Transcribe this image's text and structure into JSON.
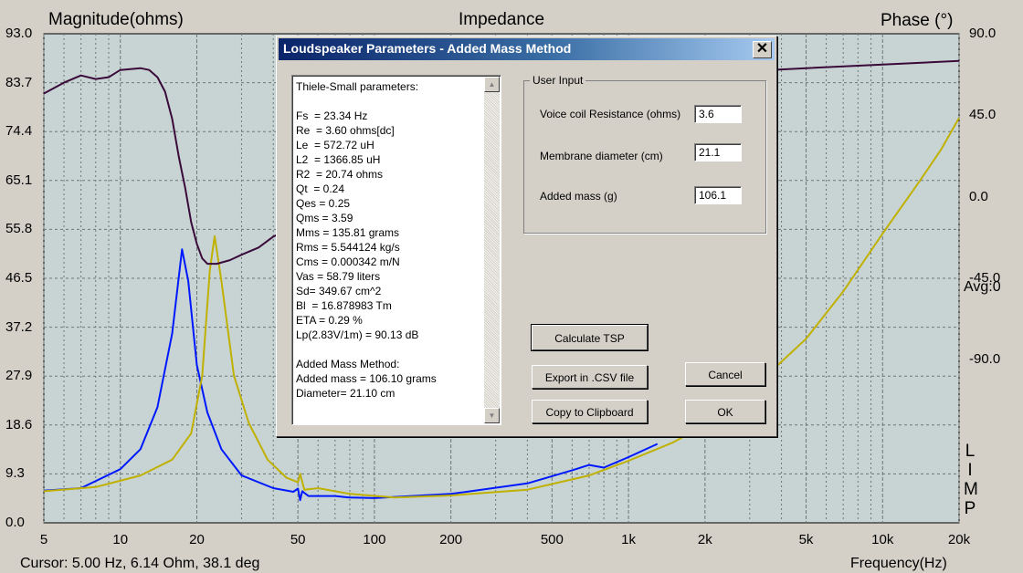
{
  "graph": {
    "title": "Impedance",
    "left_axis_title": "Magnitude(ohms)",
    "right_axis_title": "Phase (°)",
    "x_axis_title": "Frequency(Hz)",
    "avg_label": "Avg:0",
    "limp_letters": [
      "L",
      "I",
      "M",
      "P"
    ],
    "colors": {
      "background": "#c7d4d3",
      "grid": "#6e7676",
      "magnitude": "#0018ff",
      "magnitude_added_mass": "#c0b000",
      "phase": "#3a0a3a"
    }
  },
  "chart_data": {
    "type": "line",
    "title": "Impedance",
    "xlabel": "Frequency(Hz)",
    "ylabel": "Magnitude(ohms)",
    "y2label": "Phase (°)",
    "x_scale": "log",
    "xlim": [
      5,
      20000
    ],
    "ylim": [
      0.0,
      93.0
    ],
    "y2lim": [
      -180.0,
      90.0
    ],
    "x_ticks": [
      "5",
      "10",
      "20",
      "50",
      "100",
      "200",
      "500",
      "1k",
      "2k",
      "5k",
      "10k",
      "20k"
    ],
    "y_ticks": [
      "93.0",
      "83.7",
      "74.4",
      "65.1",
      "55.8",
      "46.5",
      "37.2",
      "27.9",
      "18.6",
      "9.3",
      "0.0"
    ],
    "y2_ticks": [
      "90.0",
      "45.0",
      "0.0",
      "-45.0",
      "-90.0"
    ],
    "grid": true,
    "series": [
      {
        "axis": "left",
        "color": "#0018ff",
        "points": [
          [
            5,
            6.1
          ],
          [
            7,
            6.6
          ],
          [
            10,
            10.2
          ],
          [
            12,
            14
          ],
          [
            14,
            22
          ],
          [
            16,
            36
          ],
          [
            17.5,
            52
          ],
          [
            18.5,
            46
          ],
          [
            20,
            30
          ],
          [
            22,
            21
          ],
          [
            25,
            14
          ],
          [
            30,
            9
          ],
          [
            40,
            6.6
          ],
          [
            48,
            5.9
          ],
          [
            50,
            6.5
          ],
          [
            51,
            4.3
          ],
          [
            52,
            6.0
          ],
          [
            55,
            5.1
          ],
          [
            70,
            5.1
          ],
          [
            80,
            4.8
          ],
          [
            100,
            4.7
          ],
          [
            200,
            5.5
          ],
          [
            400,
            7.5
          ],
          [
            600,
            10
          ],
          [
            700,
            11
          ],
          [
            800,
            10.5
          ],
          [
            1000,
            12.5
          ],
          [
            1300,
            15
          ]
        ]
      },
      {
        "axis": "left",
        "color": "#c0b000",
        "points": [
          [
            5,
            6.0
          ],
          [
            8,
            6.8
          ],
          [
            12,
            9
          ],
          [
            16,
            12
          ],
          [
            19,
            17
          ],
          [
            21,
            28
          ],
          [
            22.5,
            48
          ],
          [
            23.5,
            54.5
          ],
          [
            25,
            46
          ],
          [
            28,
            28
          ],
          [
            32,
            19
          ],
          [
            38,
            12
          ],
          [
            45,
            8.6
          ],
          [
            50,
            7.7
          ],
          [
            51,
            9.3
          ],
          [
            53,
            6.3
          ],
          [
            60,
            6.6
          ],
          [
            80,
            5.5
          ],
          [
            120,
            4.8
          ],
          [
            200,
            5.2
          ],
          [
            400,
            6.3
          ],
          [
            700,
            9
          ],
          [
            1000,
            11.8
          ],
          [
            1500,
            15.3
          ],
          [
            2000,
            18.6
          ],
          [
            3000,
            25
          ],
          [
            5000,
            35
          ],
          [
            7000,
            44
          ],
          [
            10000,
            55
          ],
          [
            14000,
            65
          ],
          [
            17000,
            71
          ],
          [
            20000,
            77
          ]
        ]
      },
      {
        "axis": "right",
        "color": "#3a0a3a",
        "points": [
          [
            5,
            57
          ],
          [
            6,
            63
          ],
          [
            7,
            67
          ],
          [
            8,
            65
          ],
          [
            9,
            66
          ],
          [
            10,
            70
          ],
          [
            12,
            71
          ],
          [
            13,
            70
          ],
          [
            14,
            66
          ],
          [
            15,
            58
          ],
          [
            16,
            43
          ],
          [
            17,
            22
          ],
          [
            18,
            5
          ],
          [
            19,
            -14
          ],
          [
            20,
            -26
          ],
          [
            21,
            -34
          ],
          [
            22,
            -37
          ],
          [
            24,
            -37
          ],
          [
            27,
            -35
          ],
          [
            30,
            -32
          ],
          [
            35,
            -28
          ],
          [
            40,
            -22
          ],
          [
            1000,
            66
          ],
          [
            5000,
            71
          ],
          [
            10000,
            73
          ],
          [
            20000,
            75
          ]
        ]
      }
    ]
  },
  "dialog": {
    "title": "Loudspeaker Parameters - Added Mass Method",
    "close_glyph": "✕",
    "results_text": "Thiele-Small parameters:\n\nFs  = 23.34 Hz\nRe  = 3.60 ohms[dc]\nLe  = 572.72 uH\nL2  = 1366.85 uH\nR2  = 20.74 ohms\nQt  = 0.24\nQes = 0.25\nQms = 3.59\nMms = 135.81 grams\nRms = 5.544124 kg/s\nCms = 0.000342 m/N\nVas = 58.79 liters\nSd= 349.67 cm^2\nBl  = 16.878983 Tm\nETA = 0.29 %\nLp(2.83V/1m) = 90.13 dB\n\nAdded Mass Method:\nAdded mass = 106.10 grams\nDiameter= 21.10 cm",
    "scroll_up": "▲",
    "scroll_down": "▼",
    "user_input": {
      "label": "User Input",
      "voice_coil_label": "Voice coil Resistance (ohms)",
      "voice_coil_value": "3.6",
      "membrane_label": "Membrane diameter (cm)",
      "membrane_value": "21.1",
      "added_mass_label": "Added mass (g)",
      "added_mass_value": "106.1"
    },
    "buttons": {
      "calculate": "Calculate TSP",
      "export": "Export in .CSV file",
      "copy": "Copy to Clipboard",
      "cancel": "Cancel",
      "ok": "OK"
    }
  },
  "status": {
    "cursor": "Cursor: 5.00 Hz, 6.14 Ohm, 38.1 deg"
  }
}
